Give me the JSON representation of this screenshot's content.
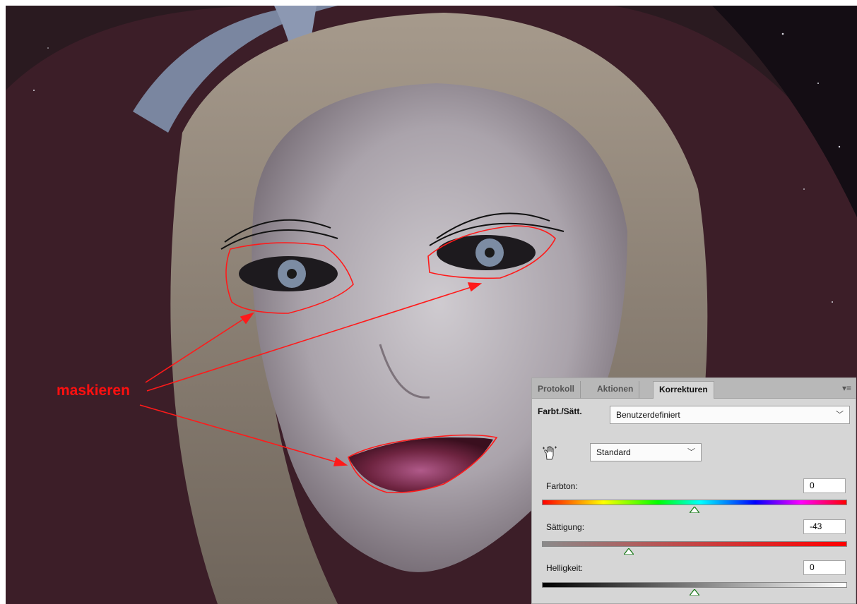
{
  "annotation": {
    "label": "maskieren",
    "color": "#ff1010"
  },
  "panel": {
    "tabs": [
      {
        "label": "Protokoll",
        "active": false
      },
      {
        "label": "Aktionen",
        "active": false
      },
      {
        "label": "Korrekturen",
        "active": true
      }
    ],
    "menu_icon": "panel-menu-icon",
    "preset_label": "Farbt./Sätt.",
    "preset_value": "Benutzerdefiniert",
    "channel_value": "Standard",
    "sliders": [
      {
        "label": "Farbton:",
        "value": "0",
        "position": 0.5
      },
      {
        "label": "Sättigung:",
        "value": "-43",
        "position": 0.285
      },
      {
        "label": "Helligkeit:",
        "value": "0",
        "position": 0.5
      }
    ]
  },
  "colors": {
    "mask_outline": "#ff1a1a",
    "panel_bg": "#d6d6d6"
  }
}
